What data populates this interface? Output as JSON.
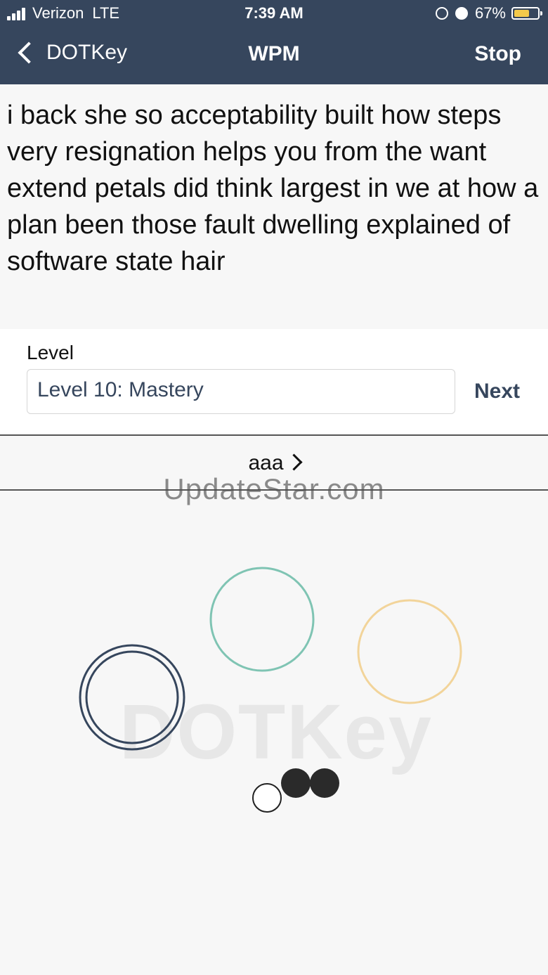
{
  "status_bar": {
    "carrier": "Verizon",
    "network": "LTE",
    "time": "7:39 AM",
    "battery_percent": "67%",
    "battery_level": 0.67,
    "battery_color": "#f3c94a"
  },
  "nav": {
    "back_label": "DOTKey",
    "title": "WPM",
    "stop_label": "Stop",
    "bg_color": "#36465d"
  },
  "prompt": {
    "text": "i back she so acceptability built how steps very resignation helps you from the want extend petals did think largest in we at how a plan been those fault dwelling explained of software state hair"
  },
  "level": {
    "label": "Level",
    "selected": "Level 10: Mastery",
    "next_label": "Next"
  },
  "sequence": {
    "text": "aaa"
  },
  "watermarks": {
    "site": "UpdateStar.com",
    "app": "DOTKey"
  },
  "keypad": {
    "keys": [
      {
        "name": "key-dark-ring",
        "color": "#36465d",
        "style": "double-ring"
      },
      {
        "name": "key-teal-ring",
        "color": "#7fc4b3",
        "style": "ring"
      },
      {
        "name": "key-yellow-ring",
        "color": "#f2d49a",
        "style": "ring"
      }
    ],
    "indicator": [
      {
        "name": "dot-empty",
        "filled": false
      },
      {
        "name": "dot-filled-1",
        "filled": true
      },
      {
        "name": "dot-filled-2",
        "filled": true
      }
    ]
  }
}
